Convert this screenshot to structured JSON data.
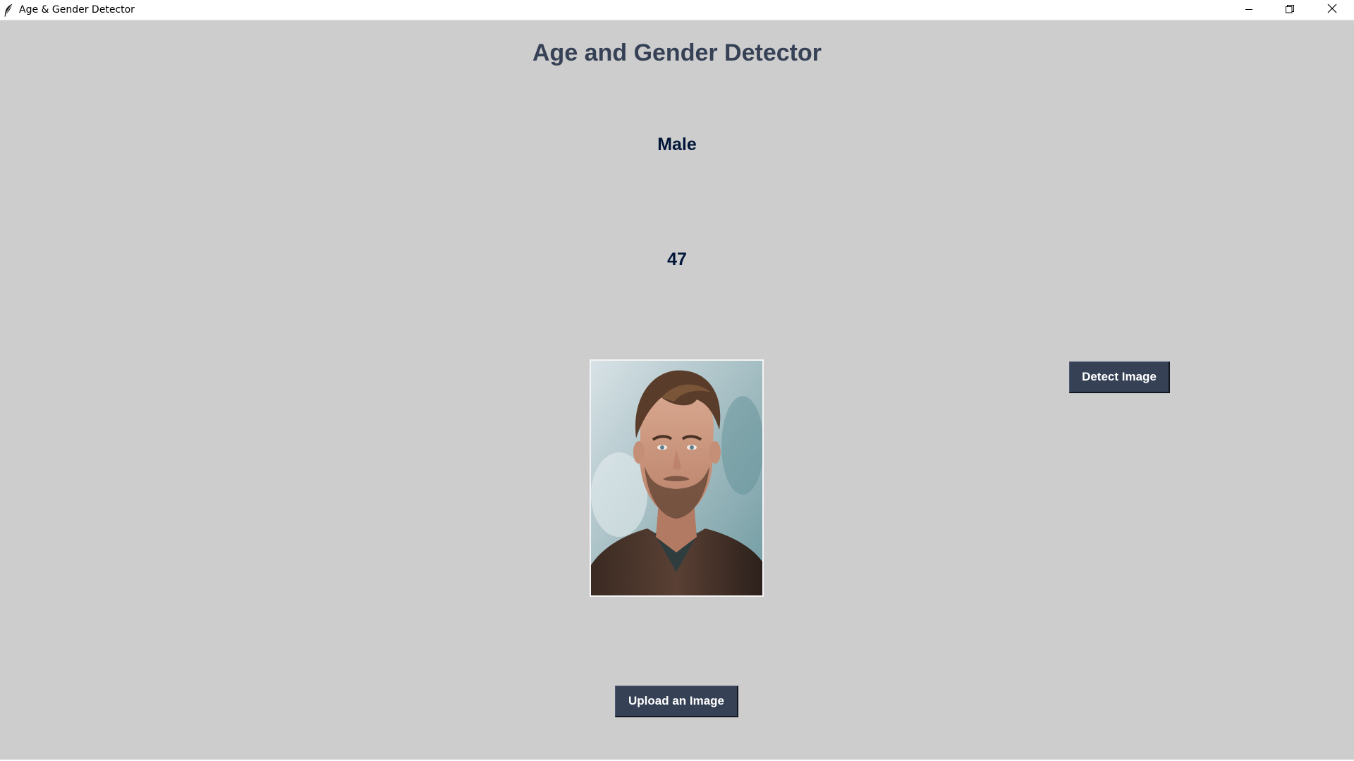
{
  "window": {
    "title": "Age & Gender Detector",
    "icons": {
      "app": "feather-icon",
      "minimize": "minimize-icon",
      "maximize": "restore-icon",
      "close": "close-icon"
    }
  },
  "main": {
    "heading": "Age and Gender Detector",
    "gender_result": "Male",
    "age_result": "47",
    "detect_button_label": "Detect Image",
    "upload_button_label": "Upload an Image"
  },
  "colors": {
    "background": "#cdcdcd",
    "heading": "#364156",
    "result_text": "#011638",
    "button_bg": "#364156",
    "button_text": "#ffffff"
  }
}
